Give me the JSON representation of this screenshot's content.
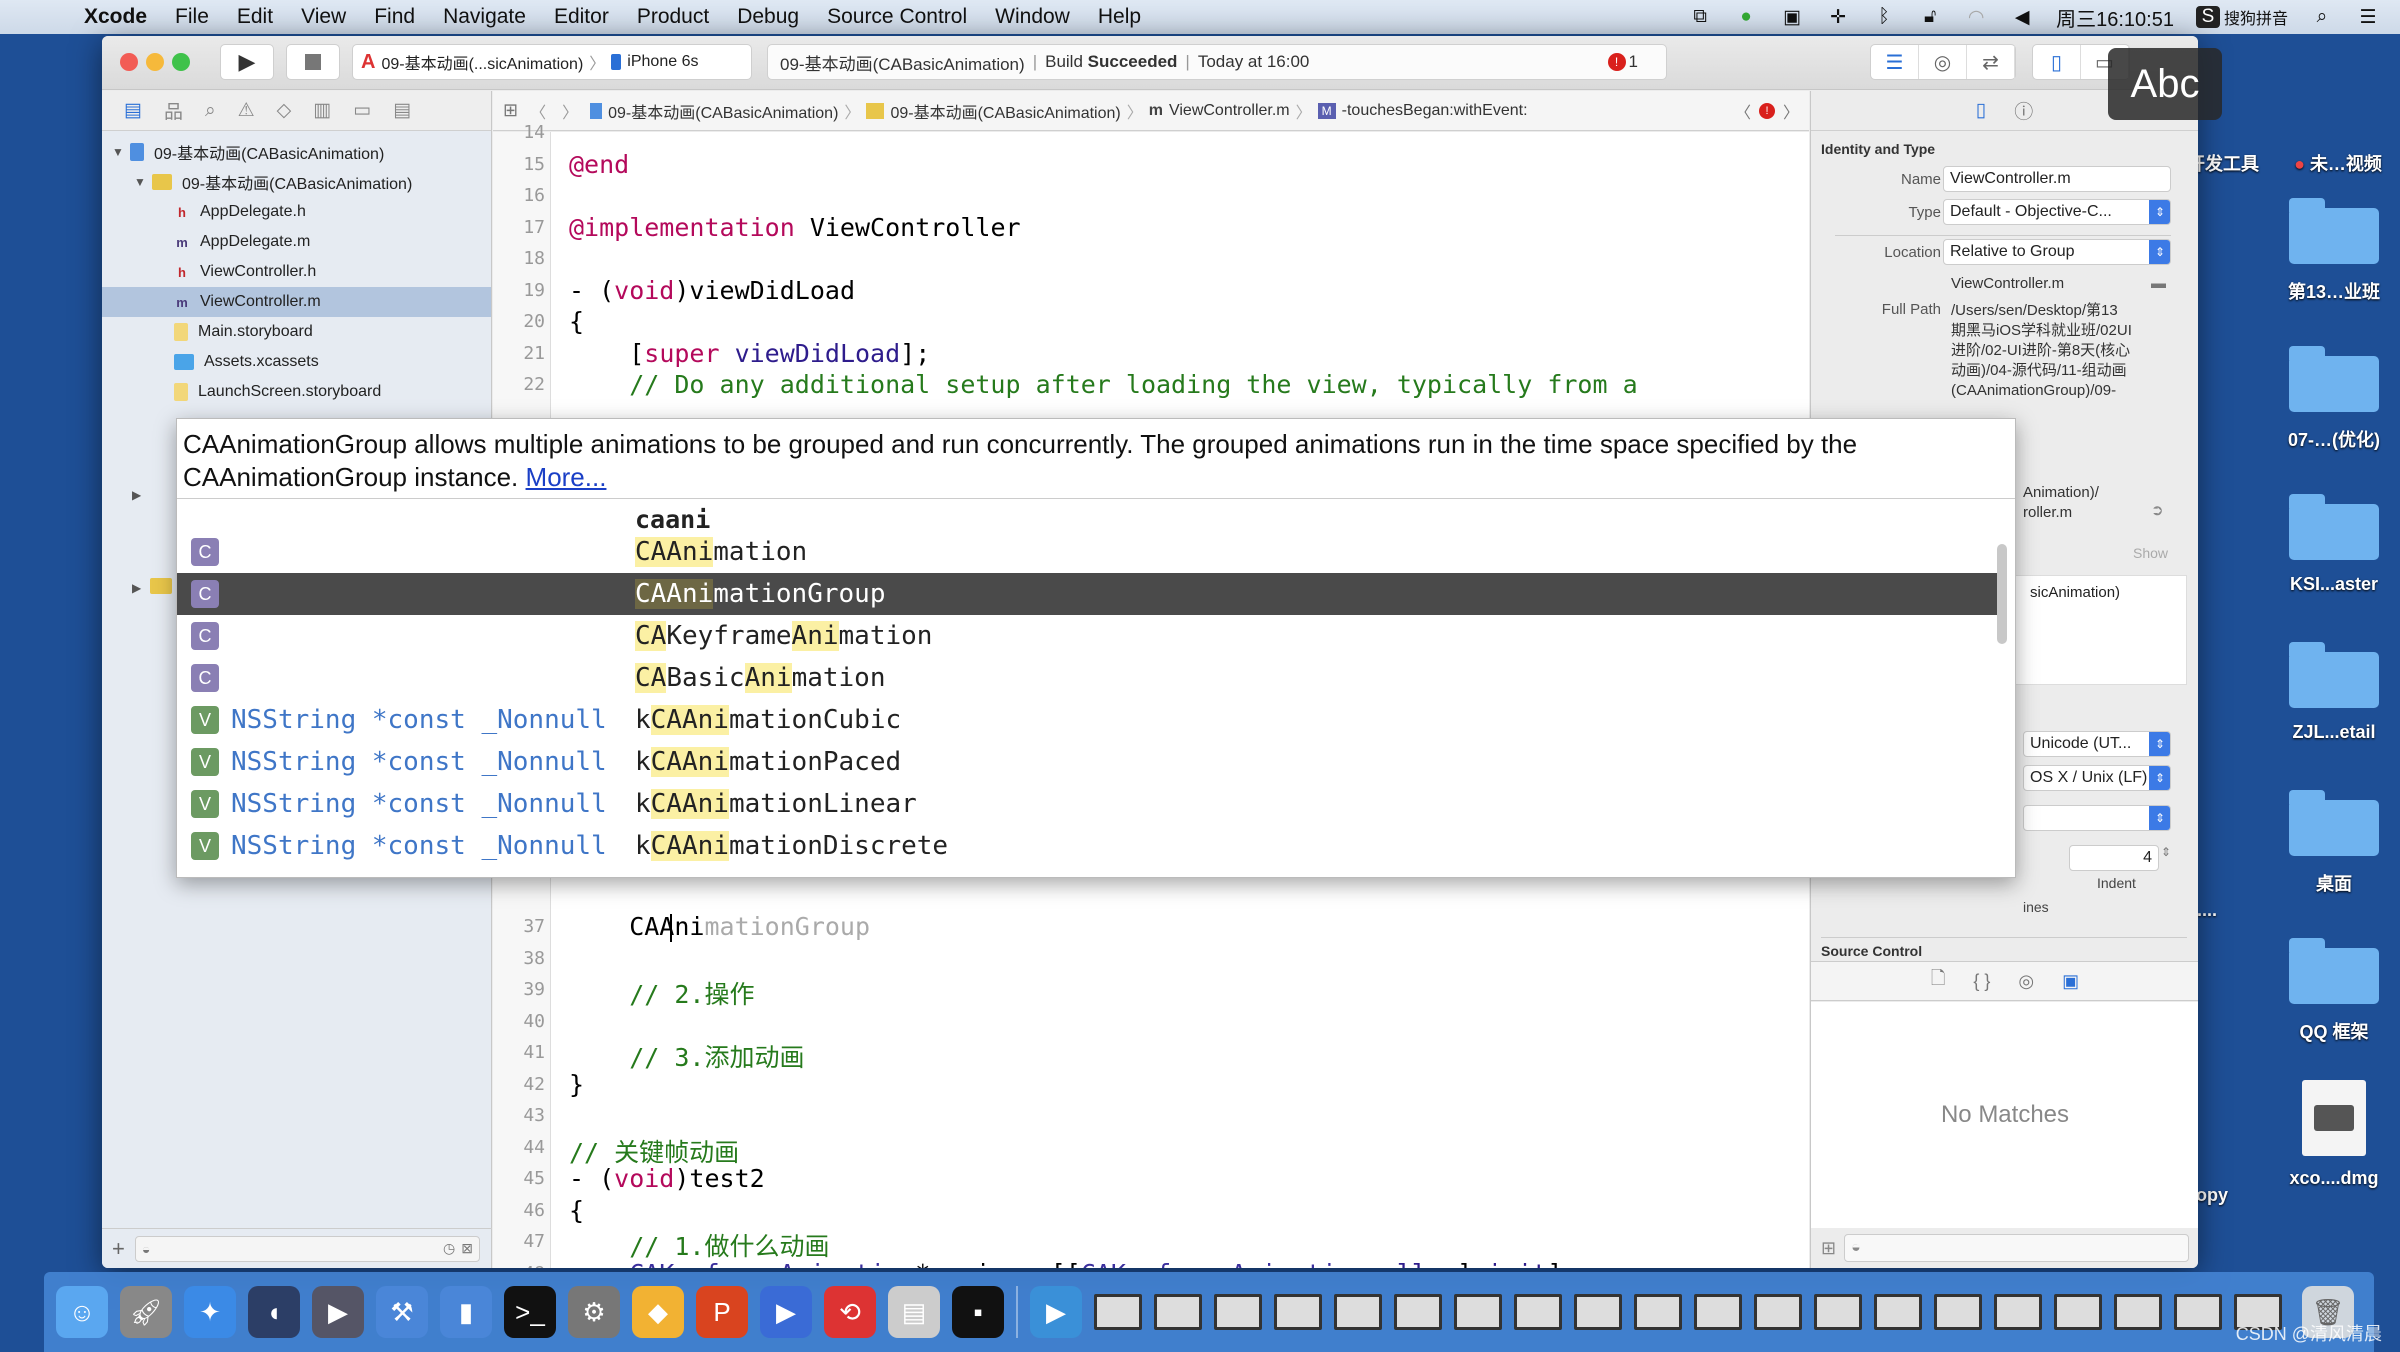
{
  "menubar": {
    "app": "Xcode",
    "items": [
      "File",
      "Edit",
      "View",
      "Find",
      "Navigate",
      "Editor",
      "Product",
      "Debug",
      "Source Control",
      "Window",
      "Help"
    ],
    "clock": "周三16:10:51",
    "input_method": "搜狗拼音"
  },
  "toolbar": {
    "scheme": "09-基本动画(...sicAnimation)",
    "device": "iPhone 6s",
    "activity_project": "09-基本动画(CABasicAnimation)",
    "build_prefix": "Build",
    "build_status": "Succeeded",
    "build_time": "Today at 16:00",
    "error_count": "1"
  },
  "input_overlay": "Abc",
  "navigator": {
    "rows": [
      {
        "label": "09-基本动画(CABasicAnimation)",
        "icon": "project-icon",
        "level": 0,
        "open": true
      },
      {
        "label": "09-基本动画(CABasicAnimation)",
        "icon": "folder-icon",
        "level": 1,
        "open": true
      },
      {
        "label": "AppDelegate.h",
        "icon": "h",
        "level": 2
      },
      {
        "label": "AppDelegate.m",
        "icon": "m",
        "level": 2
      },
      {
        "label": "ViewController.h",
        "icon": "h",
        "level": 2
      },
      {
        "label": "ViewController.m",
        "icon": "m",
        "level": 2,
        "selected": true
      },
      {
        "label": "Main.storyboard",
        "icon": "storyboard-icon",
        "level": 2
      },
      {
        "label": "Assets.xcassets",
        "icon": "assets-icon",
        "level": 2
      },
      {
        "label": "LaunchScreen.storyboard",
        "icon": "storyboard-icon",
        "level": 2
      }
    ]
  },
  "jumpbar": {
    "crumbs": [
      "09-基本动画(CABasicAnimation)",
      "09-基本动画(CABasicAnimation)",
      "ViewController.m",
      "-touchesBegan:withEvent:"
    ]
  },
  "code_top": [
    {
      "n": "14",
      "html": ""
    },
    {
      "n": "15",
      "parts": [
        [
          "kw",
          "@end"
        ]
      ]
    },
    {
      "n": "16",
      "parts": []
    },
    {
      "n": "17",
      "parts": [
        [
          "kw",
          "@implementation"
        ],
        [
          "",
          " ViewController"
        ]
      ]
    },
    {
      "n": "18",
      "parts": []
    },
    {
      "n": "19",
      "parts": [
        [
          "",
          "- ("
        ],
        [
          "kw",
          "void"
        ],
        [
          "",
          ")viewDidLoad"
        ]
      ]
    },
    {
      "n": "20",
      "parts": [
        [
          "",
          "{"
        ]
      ]
    },
    {
      "n": "21",
      "parts": [
        [
          "",
          "    ["
        ],
        [
          "kw",
          "super"
        ],
        [
          "fn",
          " viewDidLoad"
        ],
        [
          "",
          "];"
        ]
      ]
    },
    {
      "n": "22",
      "parts": [
        [
          "cm",
          "    // Do any additional setup after loading the view, typically from a"
        ]
      ]
    }
  ],
  "code_bottom": [
    {
      "n": "37",
      "parts": [
        [
          "",
          "    CAAni"
        ],
        [
          "ghost",
          "mationGroup"
        ]
      ]
    },
    {
      "n": "38",
      "parts": []
    },
    {
      "n": "39",
      "parts": [
        [
          "cm",
          "    // 2.操作"
        ]
      ]
    },
    {
      "n": "40",
      "parts": []
    },
    {
      "n": "41",
      "parts": [
        [
          "cm",
          "    // 3.添加动画"
        ]
      ]
    },
    {
      "n": "42",
      "parts": [
        [
          "",
          "}"
        ]
      ]
    },
    {
      "n": "43",
      "parts": []
    },
    {
      "n": "44",
      "parts": [
        [
          "cm",
          "// 关键帧动画"
        ]
      ]
    },
    {
      "n": "45",
      "parts": [
        [
          "",
          "- ("
        ],
        [
          "kw",
          "void"
        ],
        [
          "",
          ")test2"
        ]
      ]
    },
    {
      "n": "46",
      "parts": [
        [
          "",
          "{"
        ]
      ]
    },
    {
      "n": "47",
      "parts": [
        [
          "cm",
          "    // 1.做什么动画"
        ]
      ]
    },
    {
      "n": "48",
      "parts": [
        [
          "cls",
          "    CAKeyframeAnimation"
        ],
        [
          "",
          "* anim = [["
        ],
        [
          "cls",
          "CAKeyframeAnimation"
        ],
        [
          "fn",
          " alloc"
        ],
        [
          "",
          "] "
        ],
        [
          "fn",
          "init"
        ],
        [
          "",
          "];"
        ]
      ]
    }
  ],
  "completion": {
    "doc_text": "CAAnimationGroup allows multiple animations to be grouped and run concurrently. The grouped animations run in the time space specified by the CAAnimationGroup instance.",
    "doc_link": "More...",
    "typed": "caani",
    "items": [
      {
        "kind": "C",
        "type": "",
        "name": "CAAnimation"
      },
      {
        "kind": "C",
        "type": "",
        "name": "CAAnimationGroup",
        "selected": true
      },
      {
        "kind": "C",
        "type": "",
        "name": "CAKeyframeAnimation"
      },
      {
        "kind": "C",
        "type": "",
        "name": "CABasicAnimation"
      },
      {
        "kind": "V",
        "type": "NSString *const _Nonnull",
        "name": "kCAAnimationCubic"
      },
      {
        "kind": "V",
        "type": "NSString *const _Nonnull",
        "name": "kCAAnimationPaced"
      },
      {
        "kind": "V",
        "type": "NSString *const _Nonnull",
        "name": "kCAAnimationLinear"
      },
      {
        "kind": "V",
        "type": "NSString *const _Nonnull",
        "name": "kCAAnimationDiscrete"
      }
    ]
  },
  "inspector": {
    "section": "Identity and Type",
    "name_label": "Name",
    "name_value": "ViewController.m",
    "type_label": "Type",
    "type_value": "Default - Objective-C...",
    "location_label": "Location",
    "location_value": "Relative to Group",
    "location_file": "ViewController.m",
    "fullpath_label": "Full Path",
    "fullpath_lines": [
      "/Users/sen/Desktop/第13",
      "期黑马iOS学科就业班/02UI",
      "进阶/02-UI进阶-第8天(核心",
      "动画)/04-源代码/11-组动画",
      "(CAAnimationGroup)/09-"
    ],
    "fullpath_tail": [
      "Animation)/",
      "roller.m"
    ],
    "show": "Show",
    "target_partial": "sicAnimation)",
    "encoding": "Unicode (UT...",
    "line_endings": "OS X / Unix (LF)",
    "indent_value": "4",
    "indent_label": "Indent",
    "wrap_partial": "ines",
    "source_control": "Source Control",
    "no_matches": "No Matches"
  },
  "desktop": {
    "items": [
      "开发工具",
      "未…视频",
      "第13…业班",
      "07-…(优化)",
      "KSI...aster",
      "ZJL...etail",
      "桌面",
      "QQ 框架",
      "xco....dmg"
    ],
    "partial_labels": [
      "n)....",
      "opy"
    ]
  },
  "watermark": "CSDN @清风清晨"
}
